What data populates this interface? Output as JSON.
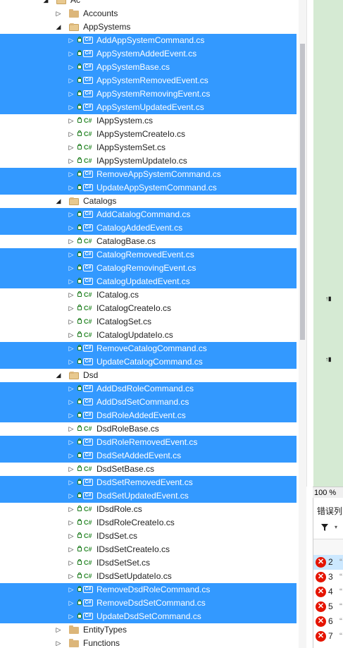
{
  "tree": {
    "rows": [
      {
        "kind": "folder",
        "label": "Ac",
        "expanded": true,
        "selected": false
      },
      {
        "kind": "folder",
        "label": "Accounts",
        "expanded": false,
        "selected": false
      },
      {
        "kind": "folder",
        "label": "AppSystems",
        "expanded": true,
        "selected": false
      },
      {
        "kind": "file",
        "label": "AddAppSystemCommand.cs",
        "selected": true
      },
      {
        "kind": "file",
        "label": "AppSystemAddedEvent.cs",
        "selected": true
      },
      {
        "kind": "file",
        "label": "AppSystemBase.cs",
        "selected": true
      },
      {
        "kind": "file",
        "label": "AppSystemRemovedEvent.cs",
        "selected": true
      },
      {
        "kind": "file",
        "label": "AppSystemRemovingEvent.cs",
        "selected": true
      },
      {
        "kind": "file",
        "label": "AppSystemUpdatedEvent.cs",
        "selected": true
      },
      {
        "kind": "file",
        "label": "IAppSystem.cs",
        "selected": false
      },
      {
        "kind": "file",
        "label": "IAppSystemCreateIo.cs",
        "selected": false
      },
      {
        "kind": "file",
        "label": "IAppSystemSet.cs",
        "selected": false
      },
      {
        "kind": "file",
        "label": "IAppSystemUpdateIo.cs",
        "selected": false
      },
      {
        "kind": "file",
        "label": "RemoveAppSystemCommand.cs",
        "selected": true
      },
      {
        "kind": "file",
        "label": "UpdateAppSystemCommand.cs",
        "selected": true
      },
      {
        "kind": "folder",
        "label": "Catalogs",
        "expanded": true,
        "selected": false
      },
      {
        "kind": "file",
        "label": "AddCatalogCommand.cs",
        "selected": true
      },
      {
        "kind": "file",
        "label": "CatalogAddedEvent.cs",
        "selected": true
      },
      {
        "kind": "file",
        "label": "CatalogBase.cs",
        "selected": false
      },
      {
        "kind": "file",
        "label": "CatalogRemovedEvent.cs",
        "selected": true
      },
      {
        "kind": "file",
        "label": "CatalogRemovingEvent.cs",
        "selected": true
      },
      {
        "kind": "file",
        "label": "CatalogUpdatedEvent.cs",
        "selected": true
      },
      {
        "kind": "file",
        "label": "ICatalog.cs",
        "selected": false
      },
      {
        "kind": "file",
        "label": "ICatalogCreateIo.cs",
        "selected": false
      },
      {
        "kind": "file",
        "label": "ICatalogSet.cs",
        "selected": false
      },
      {
        "kind": "file",
        "label": "ICatalogUpdateIo.cs",
        "selected": false
      },
      {
        "kind": "file",
        "label": "RemoveCatalogCommand.cs",
        "selected": true
      },
      {
        "kind": "file",
        "label": "UpdateCatalogCommand.cs",
        "selected": true
      },
      {
        "kind": "folder",
        "label": "Dsd",
        "expanded": true,
        "selected": false
      },
      {
        "kind": "file",
        "label": "AddDsdRoleCommand.cs",
        "selected": true
      },
      {
        "kind": "file",
        "label": "AddDsdSetCommand.cs",
        "selected": true
      },
      {
        "kind": "file",
        "label": "DsdRoleAddedEvent.cs",
        "selected": true
      },
      {
        "kind": "file",
        "label": "DsdRoleBase.cs",
        "selected": false
      },
      {
        "kind": "file",
        "label": "DsdRoleRemovedEvent.cs",
        "selected": true
      },
      {
        "kind": "file",
        "label": "DsdSetAddedEvent.cs",
        "selected": true
      },
      {
        "kind": "file",
        "label": "DsdSetBase.cs",
        "selected": false
      },
      {
        "kind": "file",
        "label": "DsdSetRemovedEvent.cs",
        "selected": true
      },
      {
        "kind": "file",
        "label": "DsdSetUpdatedEvent.cs",
        "selected": true
      },
      {
        "kind": "file",
        "label": "IDsdRole.cs",
        "selected": false
      },
      {
        "kind": "file",
        "label": "IDsdRoleCreateIo.cs",
        "selected": false
      },
      {
        "kind": "file",
        "label": "IDsdSet.cs",
        "selected": false
      },
      {
        "kind": "file",
        "label": "IDsdSetCreateIo.cs",
        "selected": false
      },
      {
        "kind": "file",
        "label": "IDsdSetSet.cs",
        "selected": false
      },
      {
        "kind": "file",
        "label": "IDsdSetUpdateIo.cs",
        "selected": false
      },
      {
        "kind": "file",
        "label": "RemoveDsdRoleCommand.cs",
        "selected": true
      },
      {
        "kind": "file",
        "label": "RemoveDsdSetCommand.cs",
        "selected": true
      },
      {
        "kind": "file",
        "label": "UpdateDsdSetCommand.cs",
        "selected": true
      },
      {
        "kind": "folder",
        "label": "EntityTypes",
        "expanded": false,
        "selected": false
      },
      {
        "kind": "folder",
        "label": "Functions",
        "expanded": false,
        "selected": false
      }
    ]
  },
  "icons": {
    "csharp_text": "C#",
    "arrow_expanded": "◢",
    "arrow_collapsed": "▷"
  },
  "editor": {
    "zoom": "100 %"
  },
  "error_list": {
    "title": "错误列",
    "filter_icon": "funnel-icon",
    "rows": [
      {
        "num": "2",
        "quote": "“",
        "selected": true
      },
      {
        "num": "3",
        "quote": "“",
        "selected": false
      },
      {
        "num": "4",
        "quote": "“",
        "selected": false
      },
      {
        "num": "5",
        "quote": "“",
        "selected": false
      },
      {
        "num": "6",
        "quote": "“",
        "selected": false
      },
      {
        "num": "7",
        "quote": "“",
        "selected": false
      }
    ]
  },
  "colors": {
    "selection": "#3399ff",
    "editor_margin": "#d5ead3",
    "error_red": "#e51400"
  }
}
